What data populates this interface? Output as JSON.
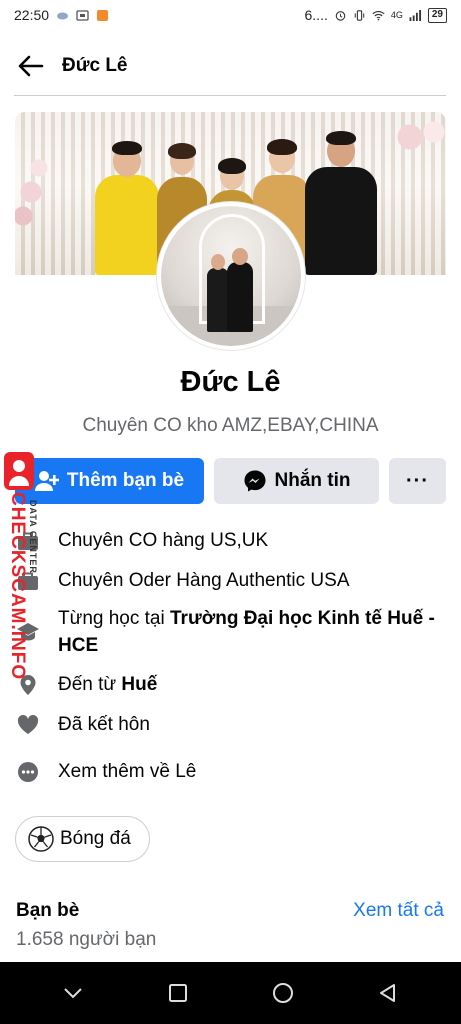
{
  "status_bar": {
    "time": "22:50",
    "network_text": "6....",
    "signal_label": "4G",
    "battery": "29"
  },
  "header": {
    "back_icon": "arrow-left-icon",
    "title": "Đức Lê"
  },
  "profile": {
    "name": "Đức Lê",
    "bio": "Chuyên CO kho AMZ,EBAY,CHINA"
  },
  "actions": {
    "add_friend_label": "Thêm bạn bè",
    "message_label": "Nhắn tin",
    "more_label": "···"
  },
  "intro": {
    "items": [
      {
        "icon": "briefcase-icon",
        "text": "Chuyên CO hàng US,UK"
      },
      {
        "icon": "briefcase-icon",
        "text": "Chuyên Oder Hàng Authentic USA"
      },
      {
        "icon": "graduation-cap-icon",
        "prefix": "Từng học tại ",
        "bold": "Trường Đại học Kinh tế Huế - HCE"
      },
      {
        "icon": "location-pin-icon",
        "prefix": "Đến từ ",
        "bold": "Huế"
      },
      {
        "icon": "heart-icon",
        "text": "Đã kết hôn"
      },
      {
        "icon": "more-dots-icon",
        "text": "Xem thêm về Lê"
      }
    ]
  },
  "hobby": {
    "icon": "soccer-ball-icon",
    "label": "Bóng đá"
  },
  "friends": {
    "title": "Bạn bè",
    "count": "1.658 người bạn",
    "see_all": "Xem tất cả"
  },
  "watermark": {
    "text": "CHECKSCAM.INFO",
    "sub": "DATA CENTER"
  },
  "colors": {
    "primary": "#1877f2",
    "secondary_bg": "#e4e6eb",
    "muted_text": "#65676b",
    "watermark_red": "#e8232a"
  }
}
